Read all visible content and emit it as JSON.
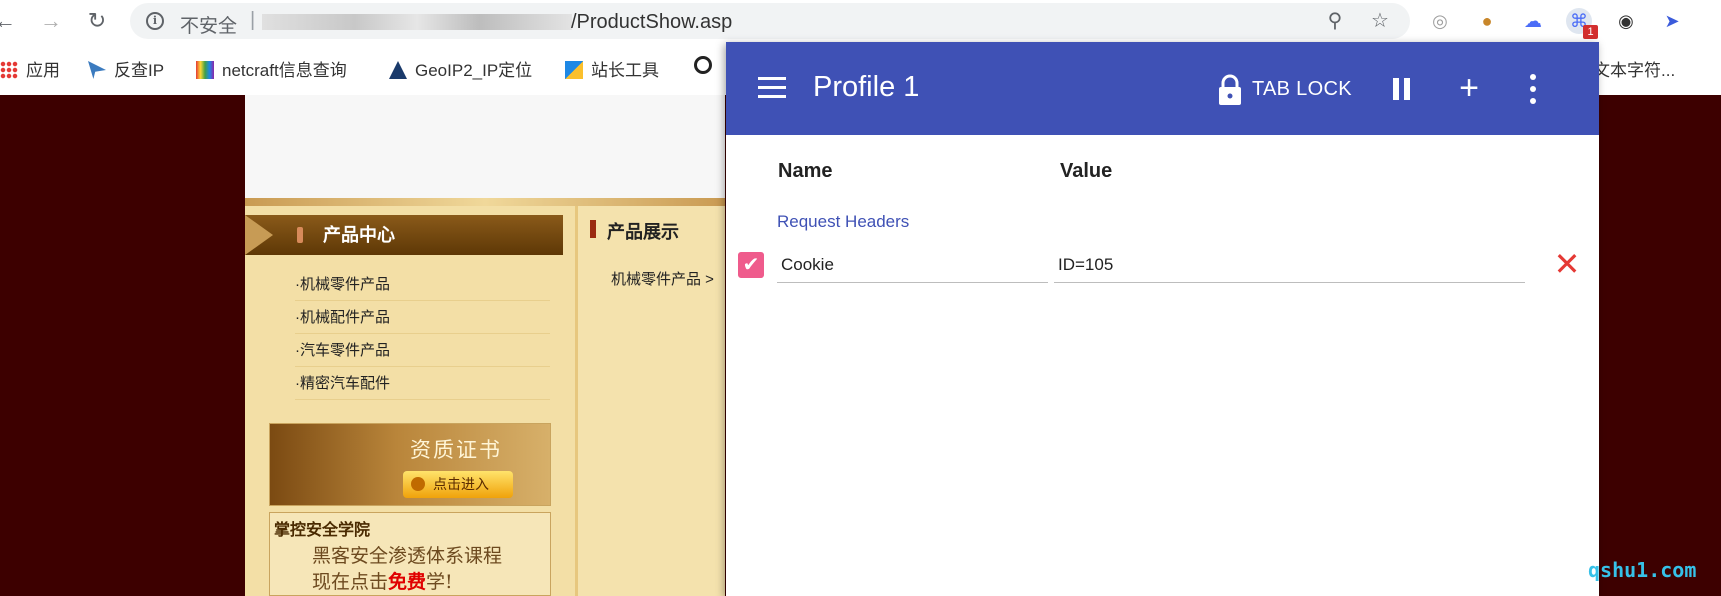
{
  "browser": {
    "omnibox": {
      "security_label": "不安全",
      "separator": "|",
      "url_path": "/ProductShow.asp"
    },
    "extension_badge": "1",
    "bookmarks": [
      {
        "label": "应用",
        "icon": "apps-grid-icon"
      },
      {
        "label": "反查IP",
        "icon": "ip-icon"
      },
      {
        "label": "netcraft信息查询",
        "icon": "netcraft-icon"
      },
      {
        "label": "GeoIP2_IP定位",
        "icon": "geoip-icon"
      },
      {
        "label": "站长工具",
        "icon": "webmaster-icon"
      },
      {
        "label": "文本字符...",
        "icon": "text-icon"
      }
    ]
  },
  "site": {
    "category_title": "产品中心",
    "category_items": [
      "·机械零件产品",
      "·机械配件产品",
      "·汽车零件产品",
      "·精密汽车配件"
    ],
    "cert_title": "资质证书",
    "cert_button": "点击进入",
    "academy_line1": "掌控安全学院",
    "academy_line2": "黑客安全渗透体系课程",
    "academy_line3_pre": "现在点击",
    "academy_line3_free": "免费",
    "academy_line3_post": "学!",
    "show_title": "产品展示",
    "breadcrumb": "机械零件产品 >"
  },
  "modheader": {
    "profile_title": "Profile 1",
    "tab_lock_label": "TAB LOCK",
    "column_name": "Name",
    "column_value": "Value",
    "section_label": "Request Headers",
    "headers": [
      {
        "enabled": true,
        "name": "Cookie",
        "value": "ID=105"
      }
    ],
    "accent_color": "#3f51b5",
    "checkbox_color": "#ef5b8c",
    "delete_color": "#e53935"
  },
  "watermark": "qshu1.com"
}
